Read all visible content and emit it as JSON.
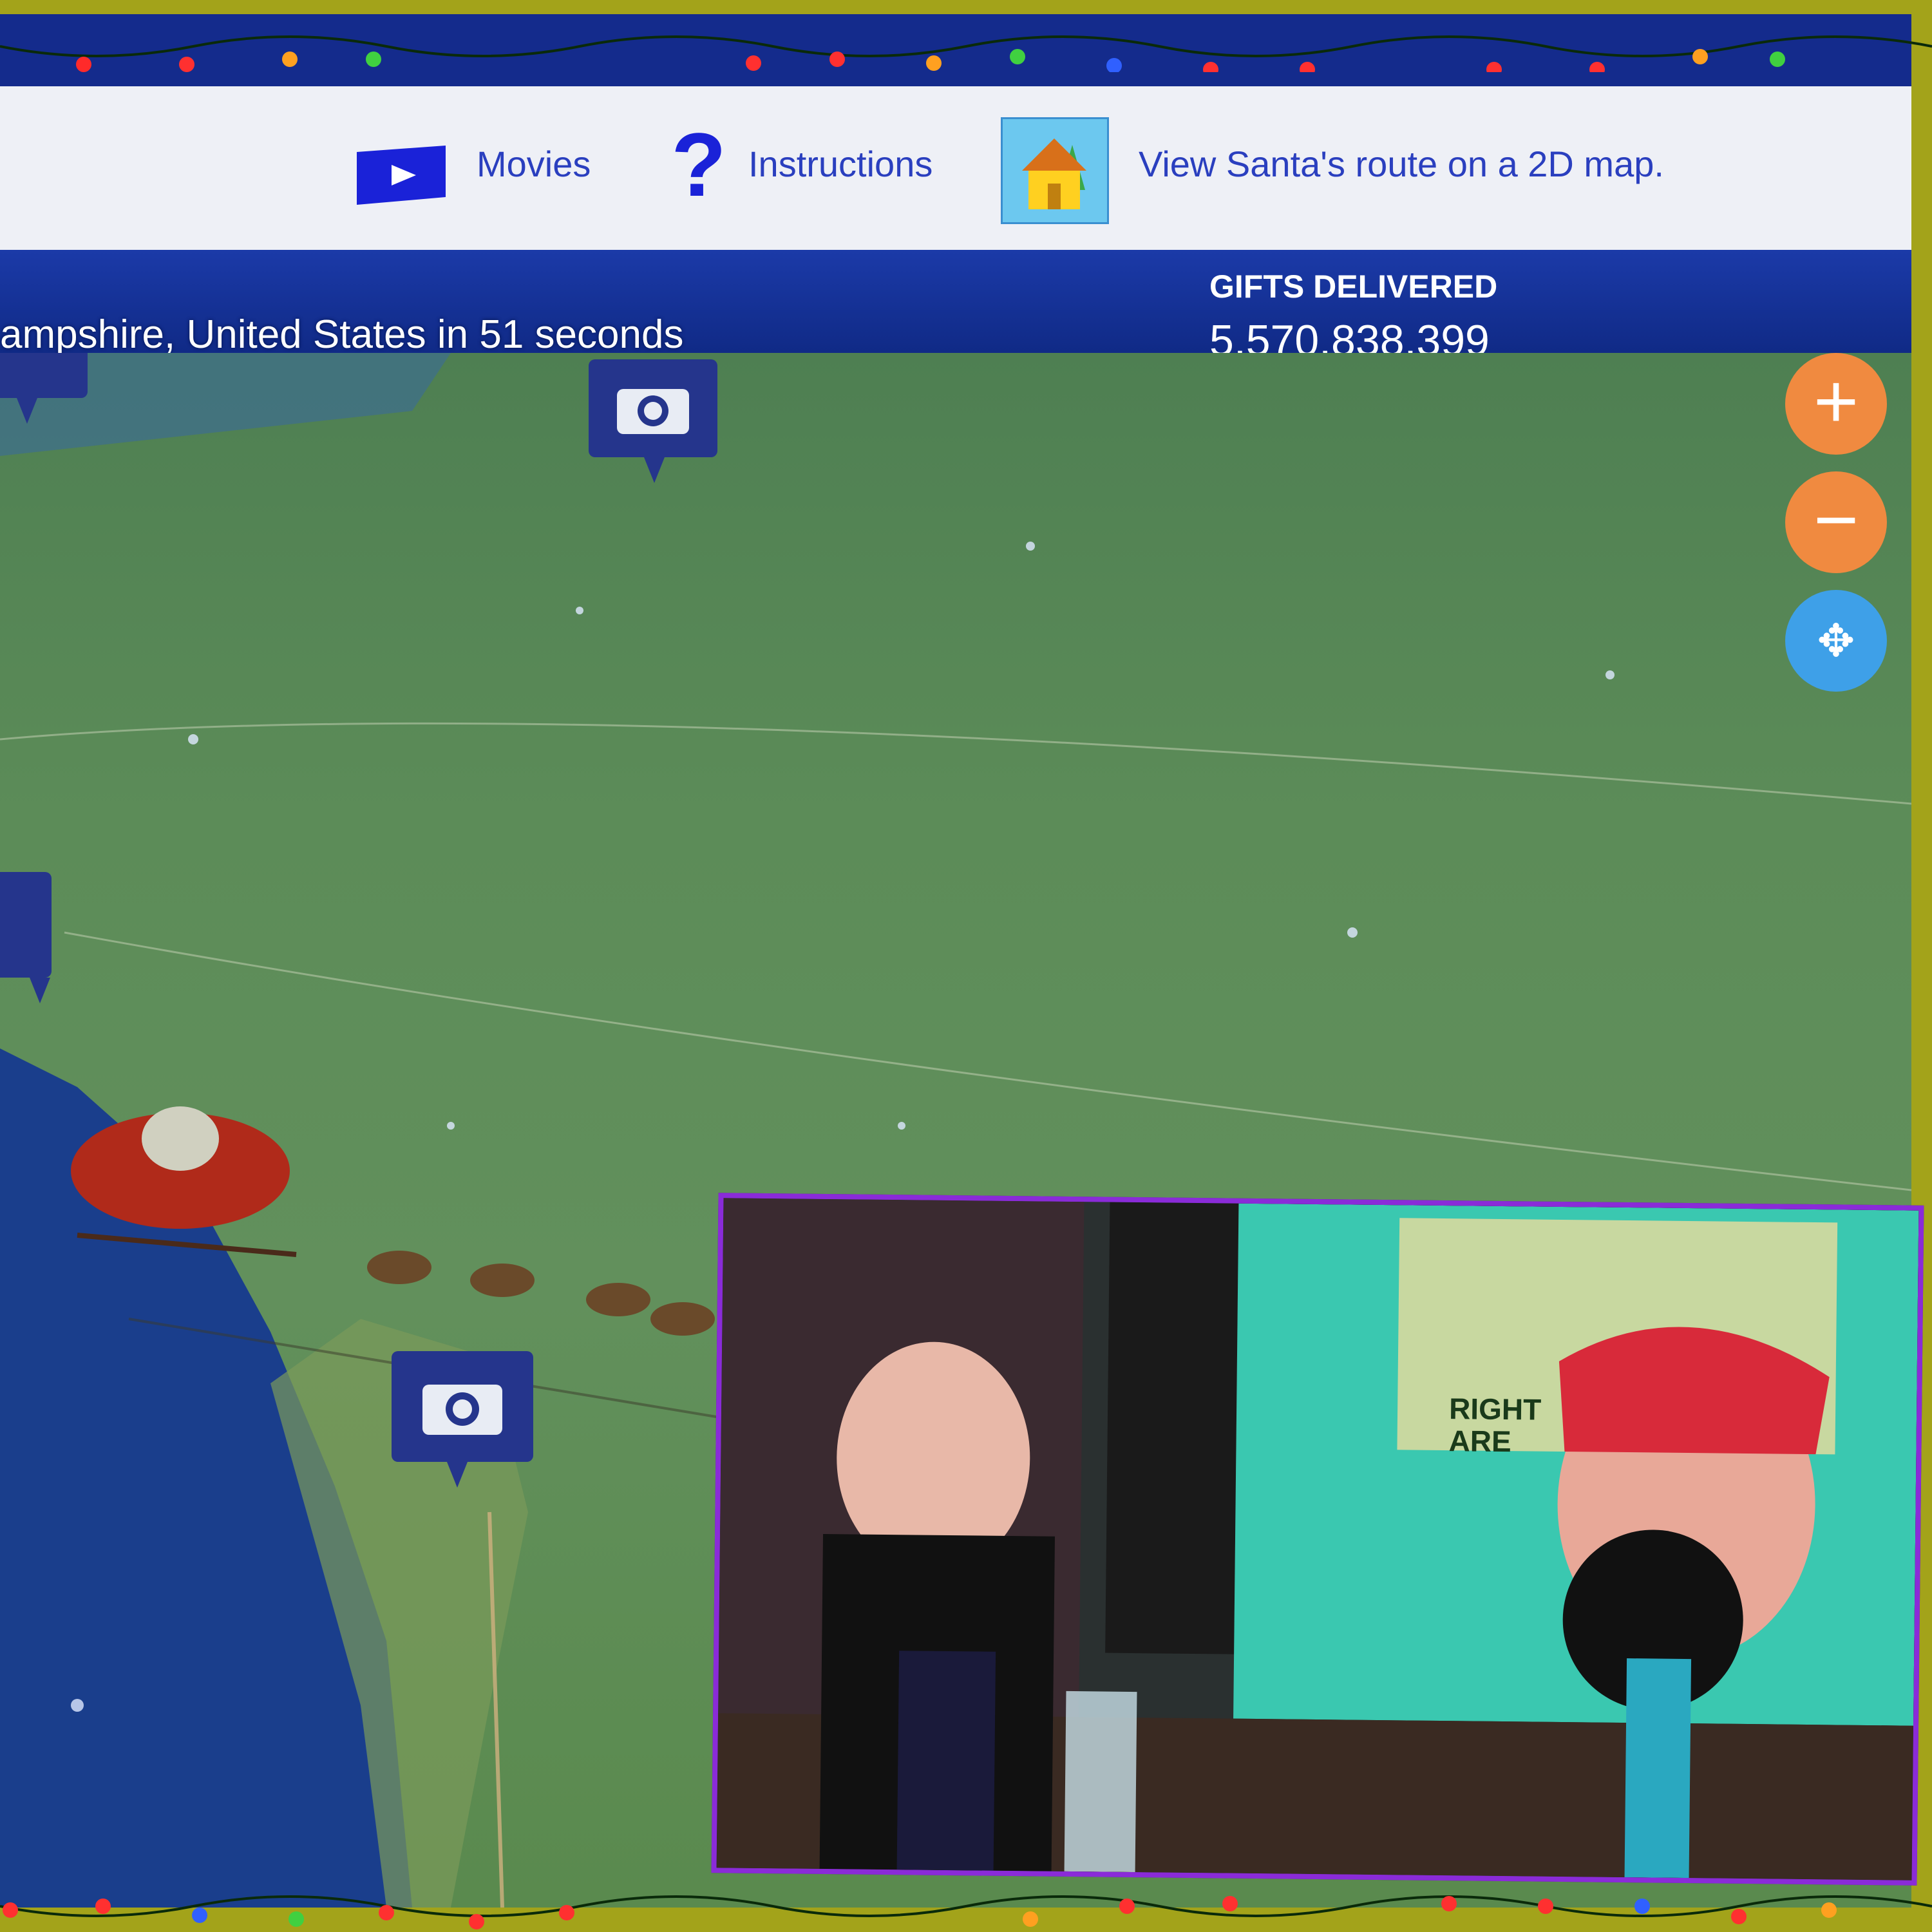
{
  "nav": {
    "movies_label": "Movies",
    "instructions_label": "Instructions",
    "instructions_icon": "?",
    "map_label": "View Santa's route on a 2D map."
  },
  "status": {
    "countdown_text": "ampshire, United States in 51 seconds",
    "gifts_label": "GIFTS DELIVERED",
    "gifts_value": "5,570,838,399"
  },
  "webcam": {
    "banner_text": "RIGHT ARE"
  },
  "map_controls": {
    "zoom_in": "+",
    "zoom_out": "−",
    "pan": "✥"
  },
  "colors": {
    "frame": "#a3a31a",
    "header_blue": "#142b8c",
    "nav_bg": "#eef0f6",
    "link_blue": "#2a3fbf",
    "zoom_orange": "#f08a40",
    "pan_blue": "#3ea0e8",
    "webcam_border": "#8a2bd8"
  }
}
